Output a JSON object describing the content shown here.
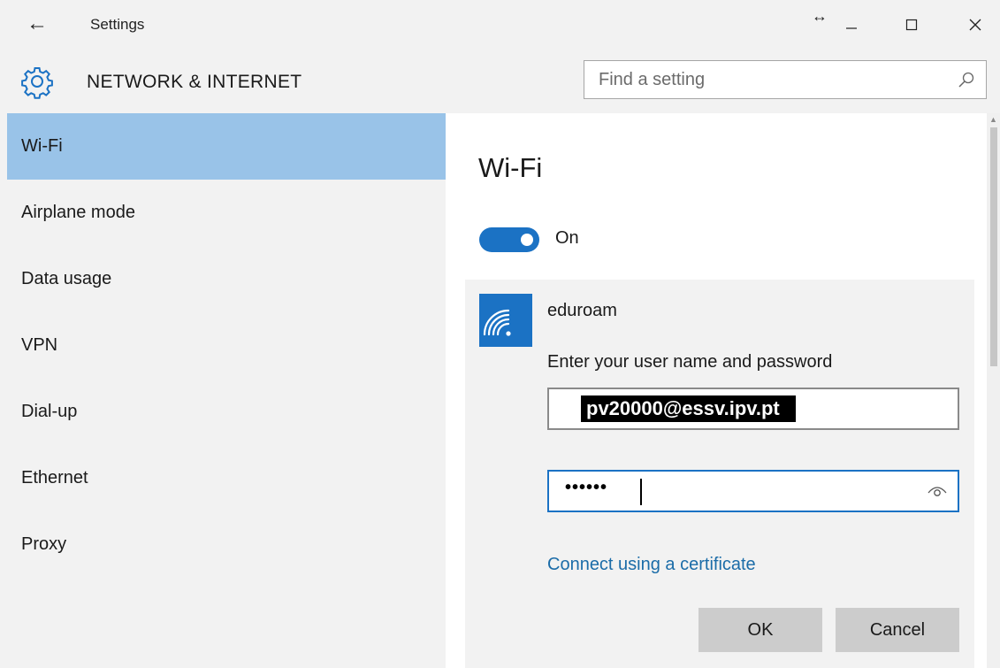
{
  "window": {
    "title": "Settings",
    "back_icon": "back-arrow-icon",
    "controls": [
      "minimize-icon",
      "maximize-icon",
      "close-icon"
    ]
  },
  "header": {
    "icon": "gear-icon",
    "title": "NETWORK & INTERNET",
    "search": {
      "placeholder": "Find a setting",
      "value": "",
      "icon": "search-icon"
    }
  },
  "sidebar": {
    "items": [
      {
        "label": "Wi-Fi",
        "active": true
      },
      {
        "label": "Airplane mode",
        "active": false
      },
      {
        "label": "Data usage",
        "active": false
      },
      {
        "label": "VPN",
        "active": false
      },
      {
        "label": "Dial-up",
        "active": false
      },
      {
        "label": "Ethernet",
        "active": false
      },
      {
        "label": "Proxy",
        "active": false
      }
    ]
  },
  "main": {
    "heading": "Wi-Fi",
    "toggle": {
      "state": "On",
      "on": true
    },
    "network": {
      "icon": "wifi-signal-icon",
      "name": "eduroam",
      "prompt": "Enter your user name and password",
      "username": "pv20000@essv.ipv.pt",
      "password_mask": "••••••",
      "reveal_icon": "eye-icon",
      "certificate_link": "Connect using a certificate",
      "ok_label": "OK",
      "cancel_label": "Cancel"
    }
  },
  "colors": {
    "accent": "#1b72c4",
    "selected_nav": "#99c3e8",
    "panel": "#f2f2f2",
    "link": "#1b6ca8",
    "button": "#cccccc"
  }
}
